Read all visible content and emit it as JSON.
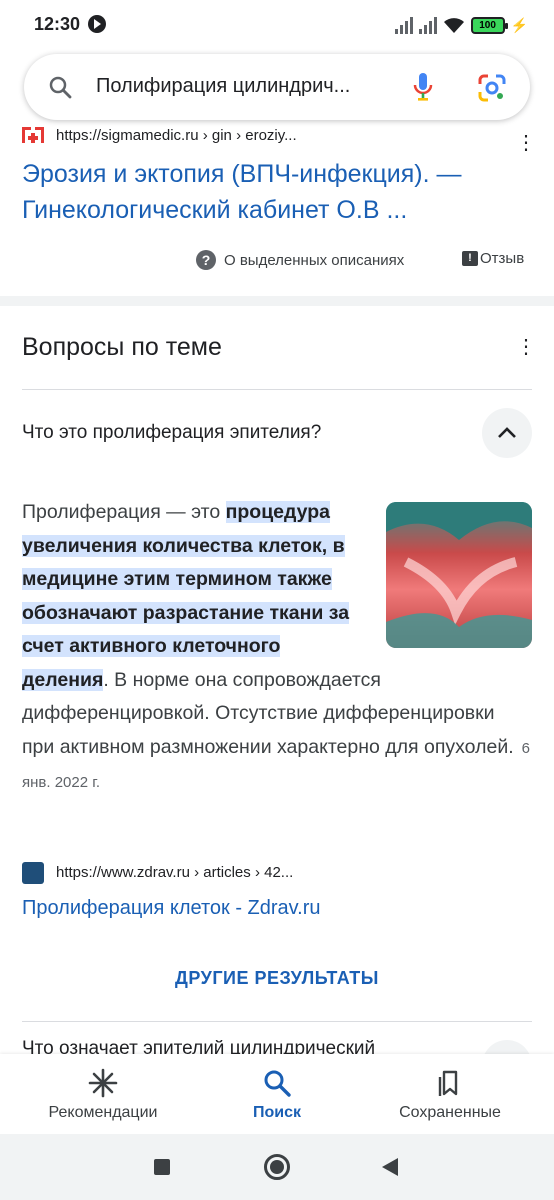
{
  "status_bar": {
    "time": "12:30",
    "battery": "100"
  },
  "search": {
    "query": "Полифирация цилиндрич..."
  },
  "result1": {
    "url": "https://sigmamedic.ru › gin › eroziy...",
    "title_line1": "Эрозия и эктопия (ВПЧ-инфекция). —",
    "title_line2": "Гинекологический кабинет О.В ...",
    "about_label": "О выделенных описаниях",
    "feedback_label": "Отзыв"
  },
  "questions": {
    "heading": "Вопросы по теме",
    "q1": "Что это пролиферация эпителия?",
    "answer_intro": "Пролиферация — это ",
    "answer_highlight": "процедура увеличения количества клеток, в медицине этим термином также обозначают разрастание ткани за счет активного клеточного деления",
    "answer_rest": ". В норме она сопровождается дифференцировкой. Отсутствие дифференцировки при активном размножении характерно для опухолей.",
    "answer_date": "6 янв. 2022 г.",
    "source_url": "https://www.zdrav.ru › articles › 42...",
    "source_title": "Пролиферация клеток - Zdrav.ru",
    "more_results": "ДРУГИЕ РЕЗУЛЬТАТЫ",
    "q2": "Что означает эпителий цилиндрический"
  },
  "bottom_nav": {
    "items": [
      {
        "label": "Рекомендации",
        "icon": "asterisk-icon"
      },
      {
        "label": "Поиск",
        "icon": "search-icon"
      },
      {
        "label": "Сохраненные",
        "icon": "bookmarks-icon"
      }
    ]
  },
  "colors": {
    "link": "#1a0dab",
    "accent": "#1a5fb4",
    "highlight": "#d3e3fd"
  }
}
